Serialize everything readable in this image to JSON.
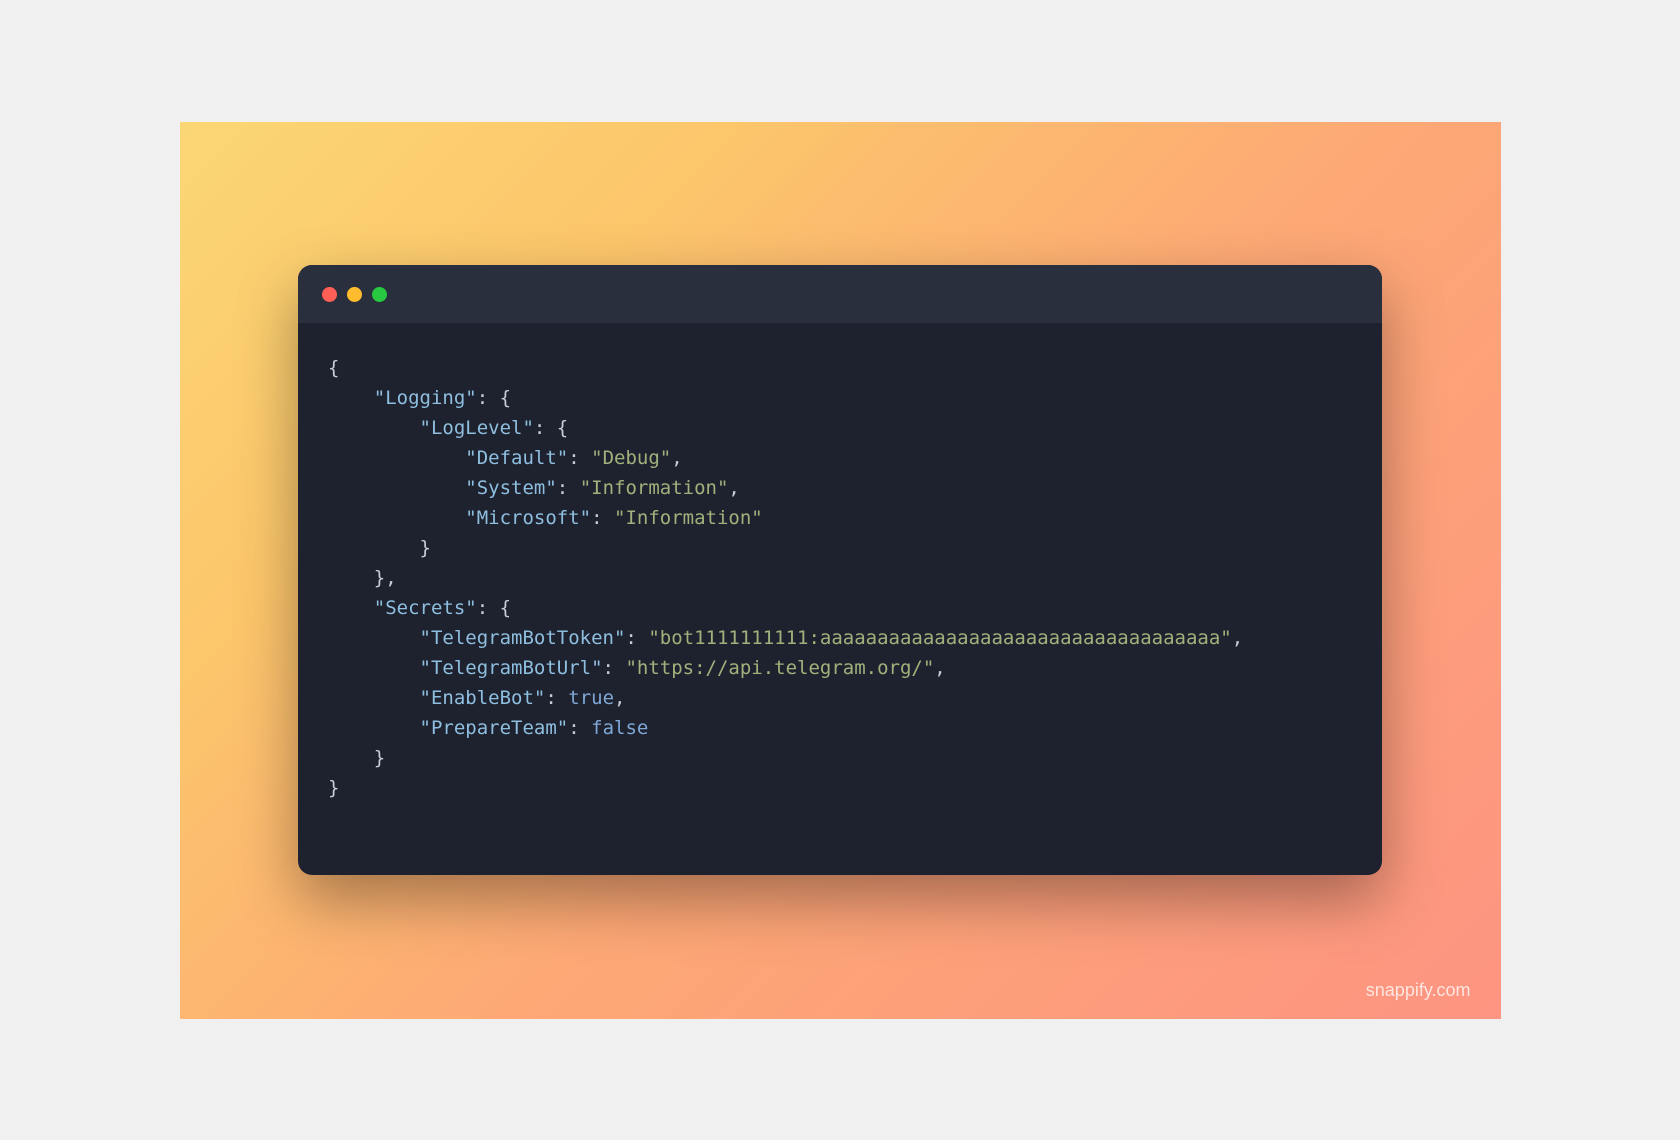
{
  "watermark": "snappify.com",
  "colors": {
    "close": "#ff5f57",
    "minimize": "#febc2e",
    "zoom": "#28c840"
  },
  "code": {
    "line1": "{",
    "line2_indent": "    ",
    "line2_key": "\"Logging\"",
    "line2_sep": ": {",
    "line3_indent": "        ",
    "line3_key": "\"LogLevel\"",
    "line3_sep": ": {",
    "line4_indent": "            ",
    "line4_key": "\"Default\"",
    "line4_sep": ": ",
    "line4_val": "\"Debug\"",
    "line4_end": ",",
    "line5_indent": "            ",
    "line5_key": "\"System\"",
    "line5_sep": ": ",
    "line5_val": "\"Information\"",
    "line5_end": ",",
    "line6_indent": "            ",
    "line6_key": "\"Microsoft\"",
    "line6_sep": ": ",
    "line6_val": "\"Information\"",
    "line7_indent": "        ",
    "line7_text": "}",
    "line8_indent": "    ",
    "line8_text": "},",
    "line9": "",
    "line10_indent": "    ",
    "line10_key": "\"Secrets\"",
    "line10_sep": ": {",
    "line11_indent": "        ",
    "line11_key": "\"TelegramBotToken\"",
    "line11_sep": ": ",
    "line11_val": "\"bot1111111111:aaaaaaaaaaaaaaaaaaaaaaaaaaaaaaaaaaa\"",
    "line11_end": ",",
    "line12_indent": "        ",
    "line12_key": "\"TelegramBotUrl\"",
    "line12_sep": ": ",
    "line12_val": "\"https://api.telegram.org/\"",
    "line12_end": ",",
    "line13_indent": "        ",
    "line13_key": "\"EnableBot\"",
    "line13_sep": ": ",
    "line13_val": "true",
    "line13_end": ",",
    "line14_indent": "        ",
    "line14_key": "\"PrepareTeam\"",
    "line14_sep": ": ",
    "line14_val": "false",
    "line15_indent": "    ",
    "line15_text": "}",
    "line16": "}"
  }
}
